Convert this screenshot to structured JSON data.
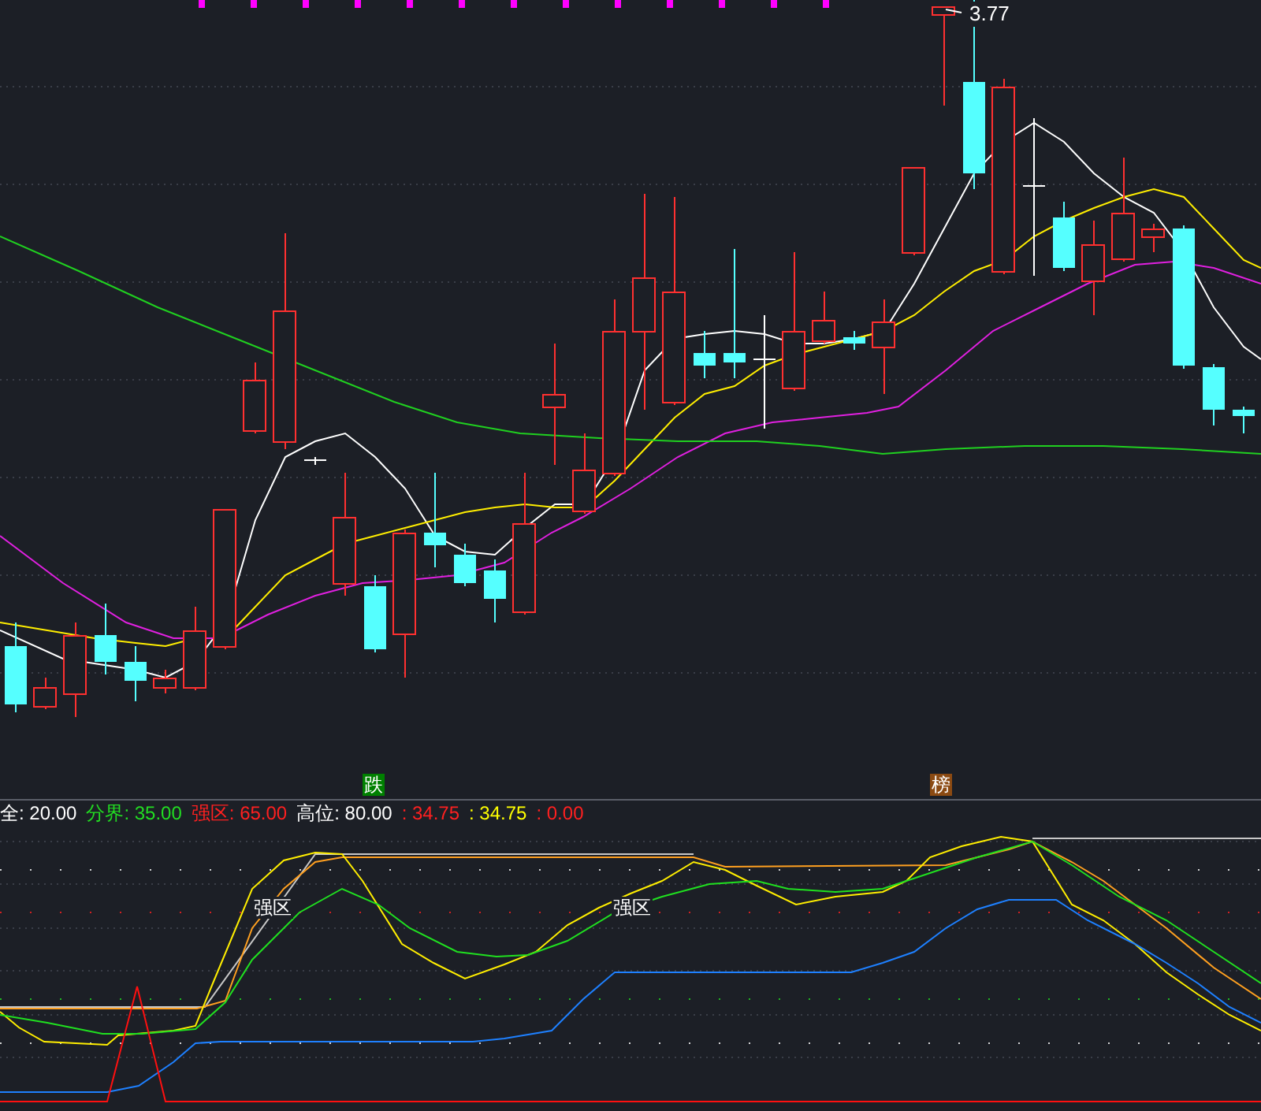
{
  "price_chart": {
    "high_label": "3.77",
    "markers": [
      {
        "text": "跌",
        "color": "#008000"
      },
      {
        "text": "榜",
        "color": "#8b4a12"
      }
    ]
  },
  "indicator": {
    "legend": [
      {
        "text": "全: 20.00",
        "color": "#ffffff"
      },
      {
        "text": "分界: 35.00",
        "color": "#22dd22"
      },
      {
        "text": "强区: 65.00",
        "color": "#ff2020"
      },
      {
        "text": "高位: 80.00",
        "color": "#ffffff"
      },
      {
        "text": ": 34.75",
        "color": "#ff2020"
      },
      {
        "text": ": 34.75",
        "color": "#ffff00"
      },
      {
        "text": ": 0.00",
        "color": "#ff2020"
      }
    ],
    "zone_labels": [
      "强区",
      "强区"
    ]
  }
}
